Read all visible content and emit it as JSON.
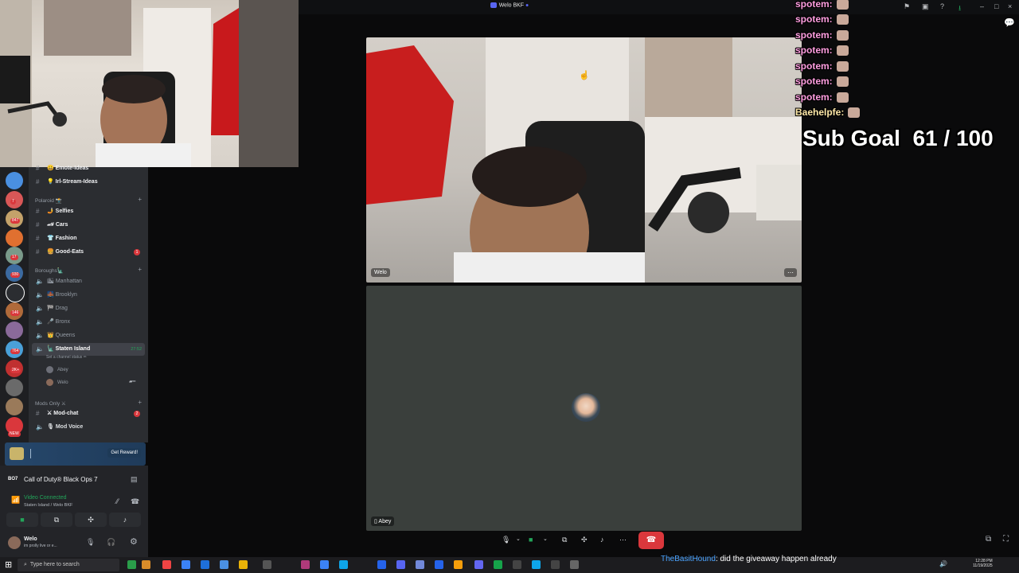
{
  "window": {
    "title": "Welo BKF"
  },
  "sidebar": {
    "server_badges": [
      "7",
      "847",
      "17",
      "930",
      "146",
      "764",
      "2K+"
    ],
    "new_badge": "NEW",
    "channels_top": [
      {
        "label": "Emote-Ideas",
        "emoji": "😀"
      },
      {
        "label": "Irl-Stream-Ideas",
        "emoji": "💡"
      }
    ],
    "category_polaroid": "Polaroid 📸",
    "polaroid_channels": [
      {
        "label": "Selfies",
        "emoji": "🤳"
      },
      {
        "label": "Cars",
        "emoji": "🏎"
      },
      {
        "label": "Fashion",
        "emoji": "👕"
      },
      {
        "label": "Good-Eats",
        "emoji": "🍔",
        "badge": "1"
      }
    ],
    "category_boroughs": "Boroughs🗽",
    "voice_channels": [
      {
        "label": "Manhattan",
        "emoji": "🏙"
      },
      {
        "label": "Brooklyn",
        "emoji": "🌉"
      },
      {
        "label": "Drag",
        "emoji": "🏁"
      },
      {
        "label": "Bronx",
        "emoji": "🎤"
      },
      {
        "label": "Queens",
        "emoji": "👑"
      }
    ],
    "active_voice": {
      "label": "Staten Island",
      "emoji": "🗽",
      "timer": "27:52",
      "status": "Set a channel status ✏"
    },
    "voice_users": [
      "Abey",
      "Welo"
    ],
    "category_mods": "Mods Only ⚔",
    "mod_channels": [
      {
        "label": "Mod-chat",
        "emoji": "⚔",
        "badge": "2",
        "kind": "text"
      },
      {
        "label": "Mod Voice",
        "emoji": "🎙",
        "kind": "voice"
      }
    ],
    "reward_button": "Get Reward!",
    "activity": "Call of Duty® Black Ops 7",
    "voice_status": "Video Connected",
    "voice_location": "Staten Island / Welo BKF",
    "user": {
      "name": "Welo",
      "status": "im prolly live or e..."
    }
  },
  "call": {
    "participants": [
      {
        "name": "Welo"
      },
      {
        "name": "Abey"
      }
    ]
  },
  "overlay": {
    "chat": [
      {
        "name": "spotem:"
      },
      {
        "name": "spotem:"
      },
      {
        "name": "spotem:"
      },
      {
        "name": "spotem:"
      },
      {
        "name": "spotem:"
      },
      {
        "name": "spotem:"
      },
      {
        "name": "spotem:"
      },
      {
        "name": "Baehelpfe:"
      }
    ],
    "sub_goal": "Sub Goal  61 / 100",
    "bottom_chat": {
      "name": "TheBasitHound",
      "message": ": did the giveaway happen already"
    }
  },
  "taskbar": {
    "search_placeholder": "Type here to search",
    "time": "12:28 PM",
    "date": "11/19/2025"
  },
  "colors": {
    "accent": "#5865f2",
    "danger": "#da373c",
    "online": "#23a55a",
    "chat_name": "#ff9ee0"
  }
}
